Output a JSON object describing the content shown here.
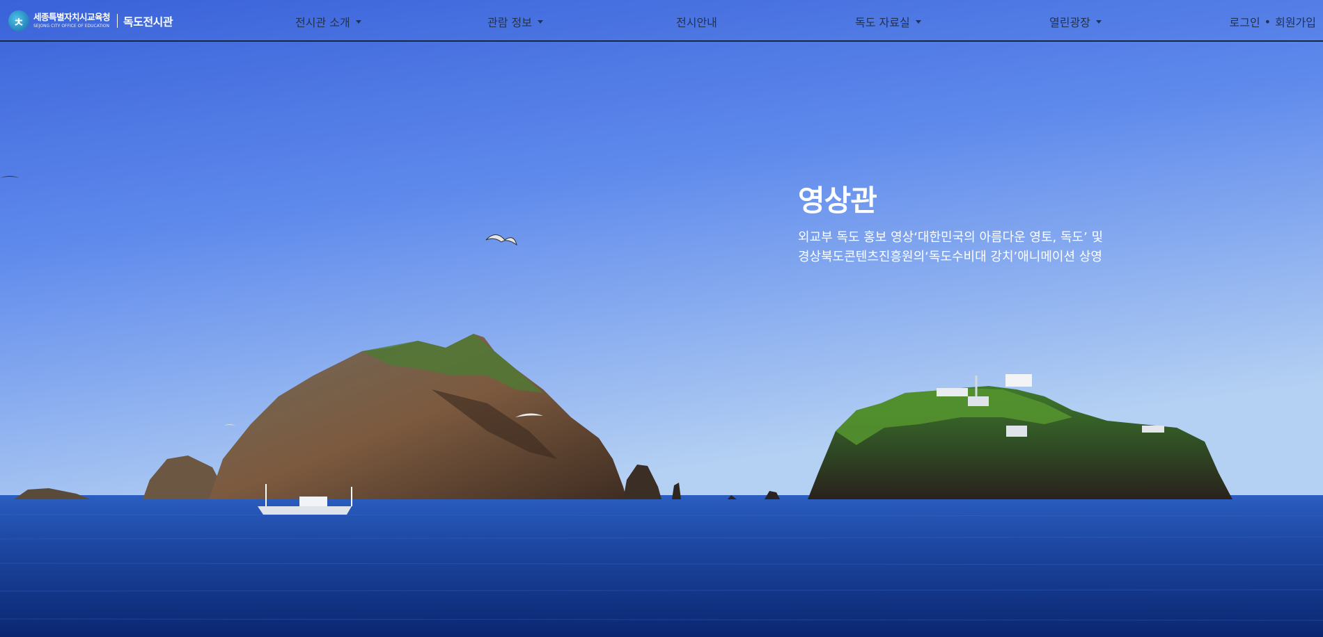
{
  "brand": {
    "org_name": "세종특별자치시교육청",
    "org_name_en": "SEJONG CITY OFFICE OF EDUCATION",
    "site_name": "독도전시관"
  },
  "nav": {
    "items": [
      {
        "label": "전시관 소개",
        "dropdown": true
      },
      {
        "label": "관람 정보",
        "dropdown": true
      },
      {
        "label": "전시안내",
        "dropdown": false
      },
      {
        "label": "독도 자료실",
        "dropdown": true
      },
      {
        "label": "열린광장",
        "dropdown": true
      }
    ],
    "login_label": "로그인",
    "separator": "•",
    "signup_label": "회원가입"
  },
  "hero": {
    "title": "영상관",
    "desc_line1": "외교부 독도 홍보 영상‘대한민국의 아름다운 영토, 독도’ 및",
    "desc_line2": "경상북도콘텐츠진흥원의‘독도수비대 강치’애니메이션 상영"
  },
  "colors": {
    "sky_top": "#3a63d8",
    "sky_bottom": "#a9c8f2",
    "sea_top": "#1e4fb5",
    "sea_bottom": "#0b2a78",
    "nav_text": "#22324f"
  }
}
